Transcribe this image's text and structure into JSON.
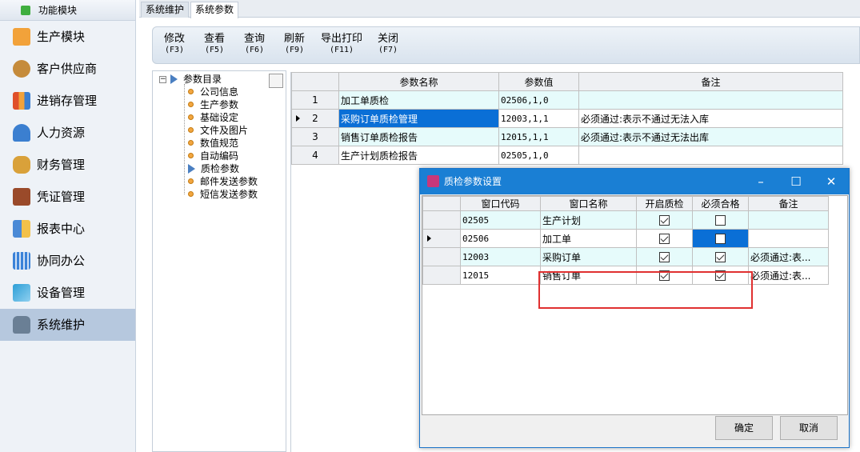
{
  "sidebar": {
    "header": "功能模块",
    "items": [
      {
        "label": "生产模块",
        "icon": "folder-icon",
        "color": "#f2a23a"
      },
      {
        "label": "客户供应商",
        "icon": "contacts-icon",
        "color": "#c58b3b"
      },
      {
        "label": "进销存管理",
        "icon": "bar-chart-icon",
        "color": "#e0502a"
      },
      {
        "label": "人力资源",
        "icon": "person-icon",
        "color": "#3b7fd0"
      },
      {
        "label": "财务管理",
        "icon": "coins-icon",
        "color": "#d9a13a"
      },
      {
        "label": "凭证管理",
        "icon": "book-icon",
        "color": "#9a4a2a"
      },
      {
        "label": "报表中心",
        "icon": "report-icon",
        "color": "#4a8ad6"
      },
      {
        "label": "协同办公",
        "icon": "calendar-icon",
        "color": "#3a82d8"
      },
      {
        "label": "设备管理",
        "icon": "monitor-icon",
        "color": "#2c9ed6"
      },
      {
        "label": "系统维护",
        "icon": "lock-icon",
        "color": "#6a7f95"
      }
    ]
  },
  "tabs": [
    "系统维护",
    "系统参数"
  ],
  "toolbar": {
    "buttons": [
      {
        "label": "修改",
        "key": "(F3)"
      },
      {
        "label": "查看",
        "key": "(F5)"
      },
      {
        "label": "查询",
        "key": "(F6)"
      },
      {
        "label": "刷新",
        "key": "(F9)"
      },
      {
        "label": "导出打印",
        "key": "(F11)"
      },
      {
        "label": "关闭",
        "key": "(F7)"
      }
    ]
  },
  "tree": {
    "root": "参数目录",
    "children": [
      "公司信息",
      "生产参数",
      "基础设定",
      "文件及图片",
      "数值规范",
      "自动编码",
      "质检参数",
      "邮件发送参数",
      "短信发送参数"
    ]
  },
  "grid": {
    "headers": [
      "参数名称",
      "参数值",
      "备注"
    ],
    "rows": [
      {
        "num": "1",
        "name": "加工单质检",
        "value": "02506,1,0",
        "note": ""
      },
      {
        "num": "2",
        "name": "采购订单质检管理",
        "value": "12003,1,1",
        "note": "必须通过:表示不通过无法入库"
      },
      {
        "num": "3",
        "name": "销售订单质检报告",
        "value": "12015,1,1",
        "note": "必须通过:表示不通过无法出库"
      },
      {
        "num": "4",
        "name": "生产计划质检报告",
        "value": "02505,1,0",
        "note": ""
      }
    ]
  },
  "dialog": {
    "title": "质检参数设置",
    "headers": [
      "窗口代码",
      "窗口名称",
      "开启质检",
      "必须合格",
      "备注"
    ],
    "rows": [
      {
        "code": "02505",
        "name": "生产计划",
        "enable": true,
        "must": false,
        "note": ""
      },
      {
        "code": "02506",
        "name": "加工单",
        "enable": true,
        "must": false,
        "note": ""
      },
      {
        "code": "12003",
        "name": "采购订单",
        "enable": true,
        "must": true,
        "note": "必须通过:表..."
      },
      {
        "code": "12015",
        "name": "销售订单",
        "enable": true,
        "must": true,
        "note": "必须通过:表..."
      }
    ],
    "ok": "确定",
    "cancel": "取消",
    "controls": {
      "minimize": "–",
      "maximize": "☐",
      "close": "✕"
    }
  }
}
